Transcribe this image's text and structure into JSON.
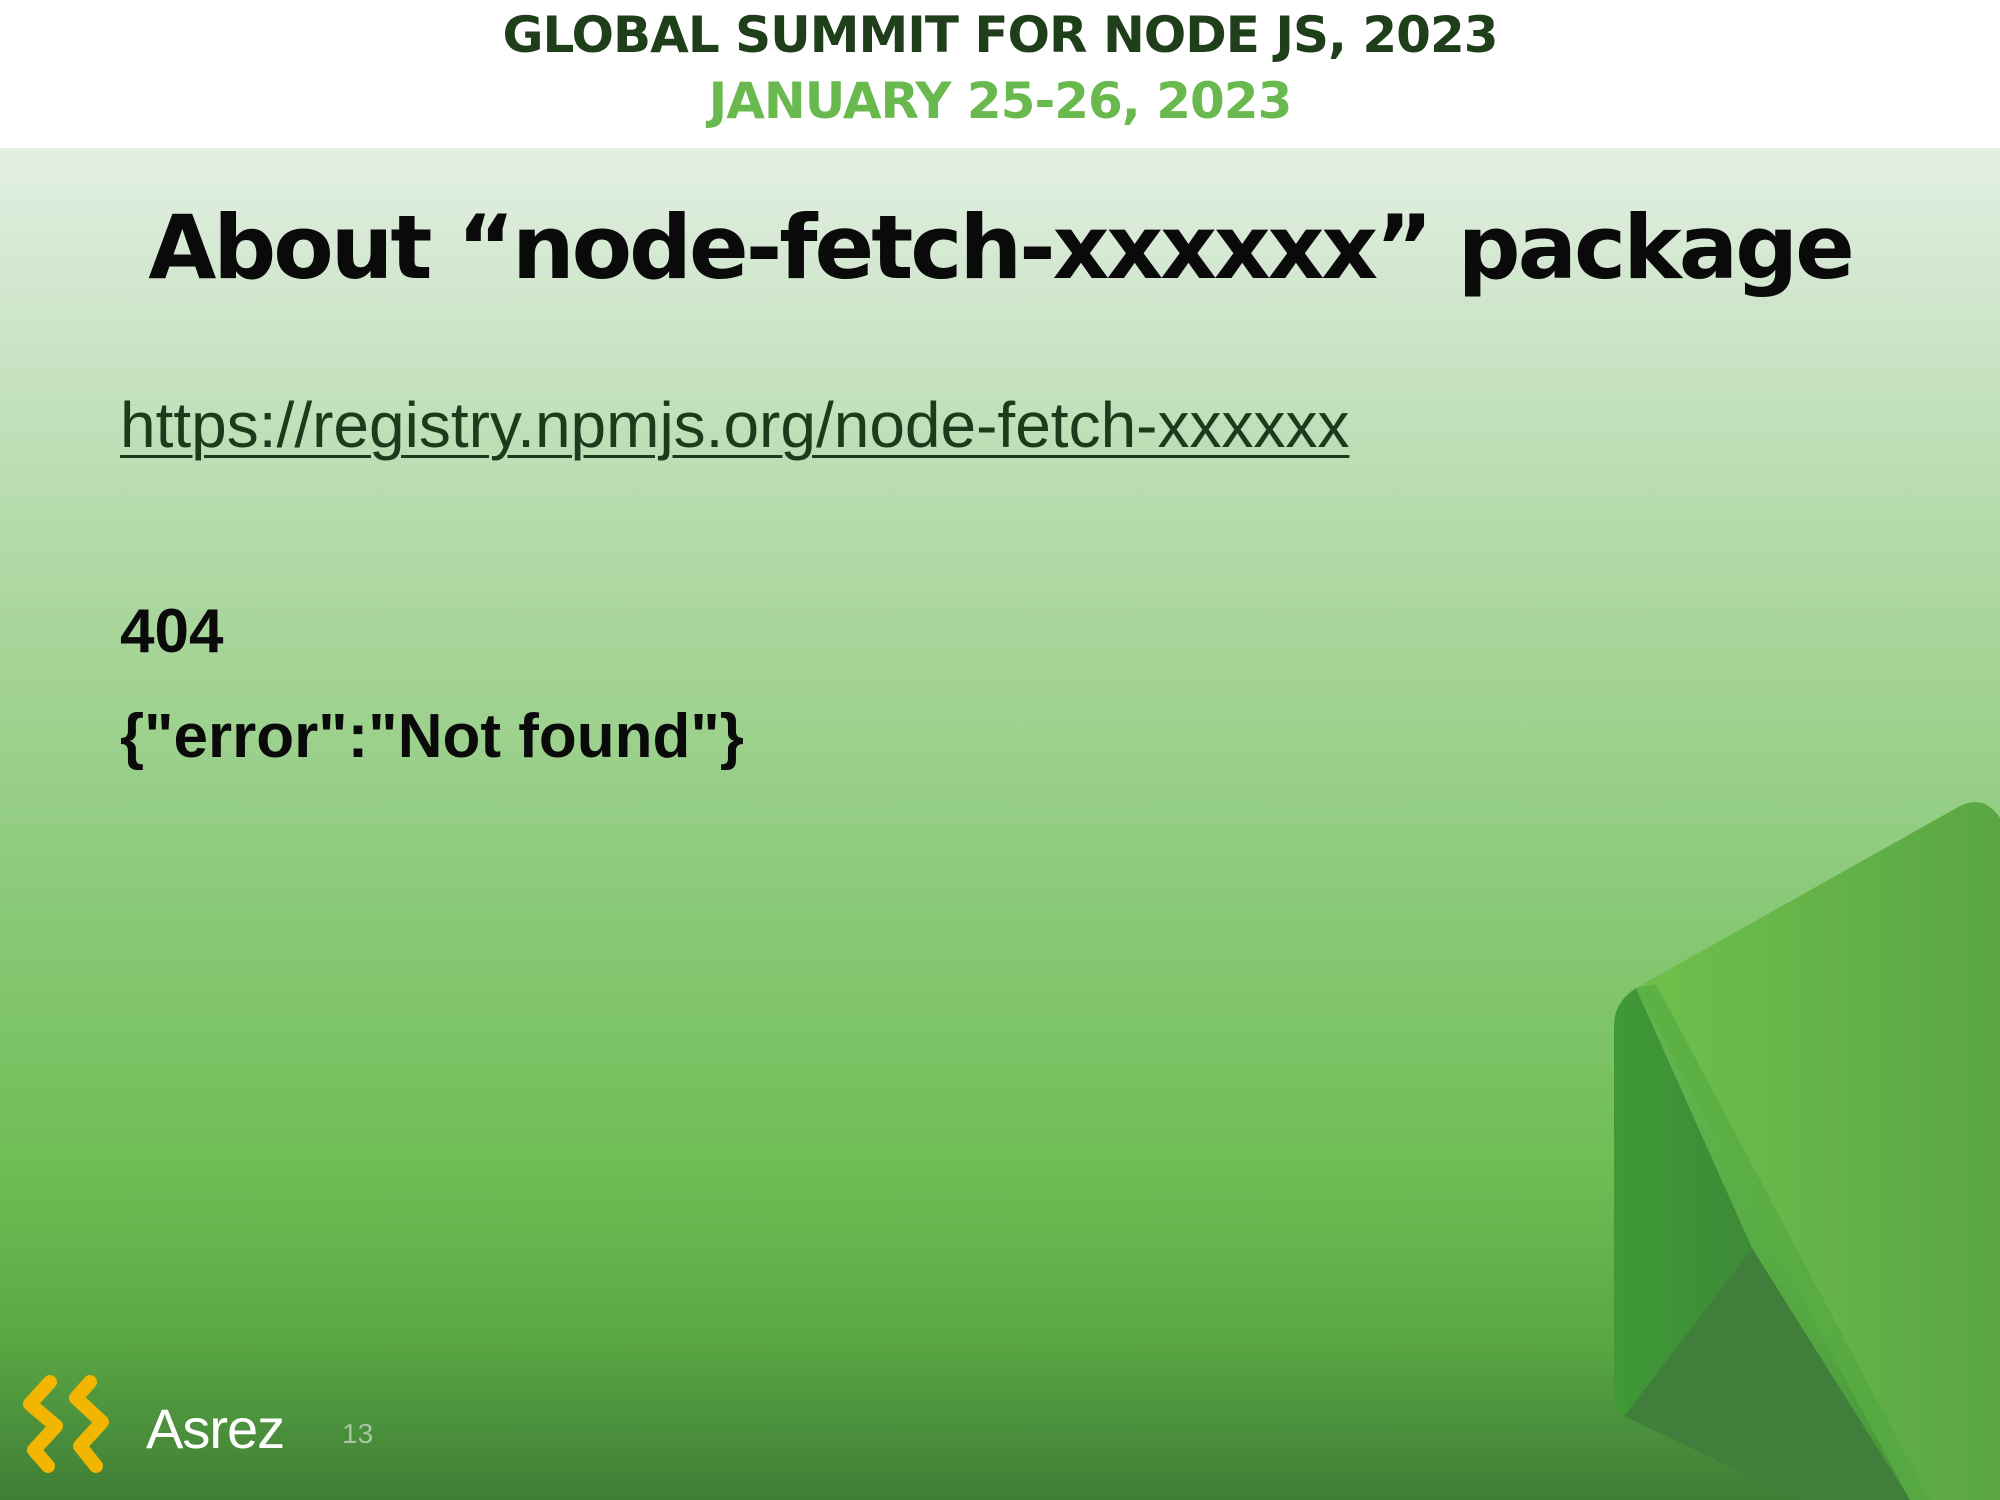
{
  "header": {
    "event_title": "GLOBAL SUMMIT FOR NODE JS, 2023",
    "event_date": "JANUARY 25-26, 2023"
  },
  "slide": {
    "title": "About “node-fetch-xxxxxx” package",
    "registry_link": "https://registry.npmjs.org/node-fetch-xxxxxx",
    "status_code": "404",
    "error_body": "{\"error\":\"Not found\"}"
  },
  "footer": {
    "brand_name": "Asrez",
    "page_number": "13"
  },
  "icons": {
    "logo": "asrez-logo-icon",
    "decoration": "nodejs-hexagon-icon"
  },
  "colors": {
    "header_dark": "#1f3f1a",
    "header_accent": "#6ab94e",
    "logo_yellow": "#f2b600",
    "node_green": "#5fb442"
  }
}
